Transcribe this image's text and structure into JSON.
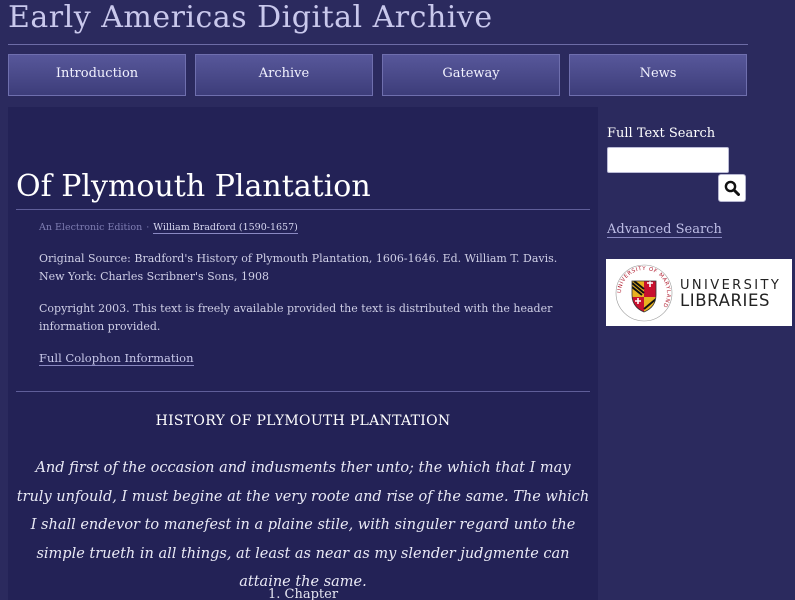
{
  "site": {
    "title": "Early Americas Digital Archive"
  },
  "nav": {
    "items": [
      "Introduction",
      "Archive",
      "Gateway",
      "News"
    ]
  },
  "document": {
    "title": "Of Plymouth Plantation",
    "edition_label": "An Electronic Edition",
    "edition_separator": "·",
    "author": "William Bradford (1590-1657)",
    "source": "Original Source: Bradford's History of Plymouth Plantation, 1606-1646. Ed. William T. Davis. New York: Charles Scribner's Sons, 1908",
    "copyright": "Copyright 2003. This text is freely available provided the text is distributed with the header information provided.",
    "colophon_link": "Full Colophon Information",
    "section_heading": "HISTORY OF PLYMOUTH PLANTATION",
    "body": "And first of the occasion and indusments ther unto; the which that I may truly unfould, I must begine at the very roote and rise of the same. The which I shall endevor to manefest in a plaine stile, with singuler regard unto the simple trueth in all things, at least as near as my slender judgmente can attaine the same.",
    "chapter": "1. Chapter"
  },
  "sidebar": {
    "search_label": "Full Text Search",
    "search_value": "",
    "search_icon": "magnifier-icon",
    "advanced_search": "Advanced Search",
    "library_logo": {
      "line1": "UNIVERSITY",
      "line2": "LIBRARIES",
      "seal_text": "UNIVERSITY OF MARYLAND"
    }
  },
  "colors": {
    "page_bg": "#2b2a5e",
    "content_bg": "#232256",
    "nav_tab": "#4a4a8a"
  }
}
